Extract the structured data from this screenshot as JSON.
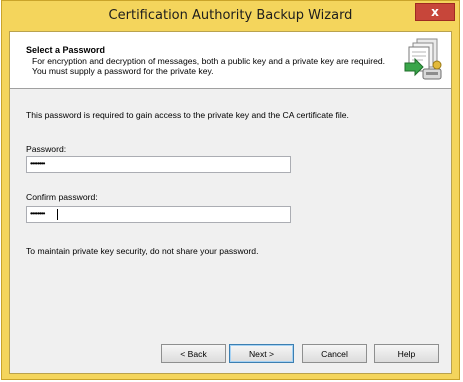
{
  "window": {
    "title": "Certification Authority Backup Wizard",
    "close_label": "x"
  },
  "header": {
    "title": "Select a Password",
    "description": "For encryption and decryption of messages, both a public key and a private key are required. You must supply a password for the private key.",
    "icon": "wizard-backup-icon"
  },
  "body": {
    "intro": "This password is required to gain access to the private key and the CA certificate file.",
    "password_label": "Password:",
    "password_value": "••••••••",
    "confirm_label": "Confirm password:",
    "confirm_value": "••••••••",
    "note": "To maintain private key security, do not share your password."
  },
  "buttons": {
    "back": "< Back",
    "next": "Next >",
    "cancel": "Cancel",
    "help": "Help"
  },
  "colors": {
    "titlebar": "#f4d55c",
    "close": "#c7463a",
    "dialog_bg": "#f0f0f0"
  }
}
